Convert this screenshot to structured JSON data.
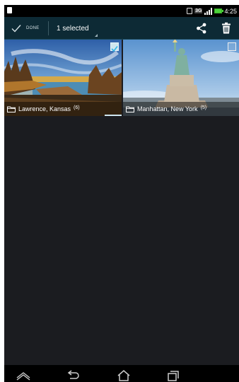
{
  "status_bar": {
    "time": "4:25",
    "icons": [
      "notification-icon",
      "vibrate-icon",
      "data-icon",
      "signal-icon",
      "battery-icon"
    ],
    "data_label": "3G",
    "battery_color": "#4cd23a"
  },
  "action_bar": {
    "done_label": "DONE",
    "selection_label": "1 selected",
    "actions": [
      "share-icon",
      "delete-icon"
    ],
    "background": "#0d2a35"
  },
  "albums": [
    {
      "name": "Lawrence, Kansas",
      "count": "(6)",
      "selected": true
    },
    {
      "name": "Manhattan, New York",
      "count": "(5)",
      "selected": false
    }
  ],
  "nav_bar": {
    "buttons": [
      "hide-nav-icon",
      "back-icon",
      "home-icon",
      "recent-apps-icon"
    ]
  },
  "colors": {
    "background": "#1b1c20",
    "accent": "#33b5e5"
  }
}
